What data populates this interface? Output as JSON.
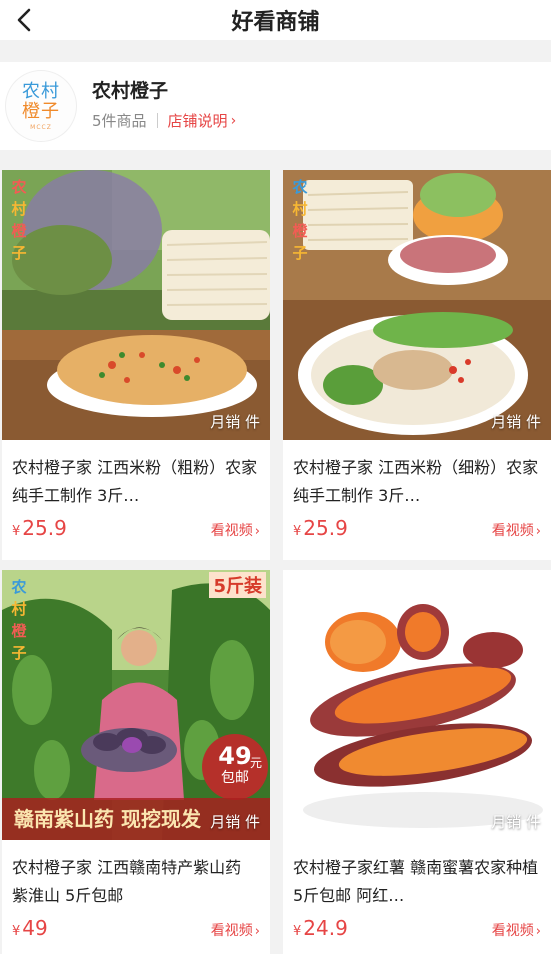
{
  "nav": {
    "title": "好看商铺"
  },
  "shop": {
    "name": "农村橙子",
    "logo": {
      "line1": "农村",
      "line2": "橙子",
      "small": "MCCZ"
    },
    "count_text": "5件商品",
    "desc_label": "店铺说明"
  },
  "products": [
    {
      "title": "农村橙子家 江西米粉（粗粉）农家纯手工制作 3斤…",
      "price": "25.9",
      "currency": "¥",
      "sales": "月销 件",
      "video_label": "看视频",
      "watermark": [
        "农",
        "村",
        "橙",
        "子"
      ]
    },
    {
      "title": "农村橙子家 江西米粉（细粉）农家纯手工制作 3斤…",
      "price": "25.9",
      "currency": "¥",
      "sales": "月销 件",
      "video_label": "看视频",
      "watermark": [
        "农",
        "村",
        "橙",
        "子"
      ]
    },
    {
      "title": "农村橙子家 江西赣南特产紫山药 紫淮山 5斤包邮",
      "price": "49",
      "currency": "¥",
      "sales": "月销 件",
      "video_label": "看视频",
      "watermark": [
        "农",
        "村",
        "橙",
        "子"
      ],
      "tag": "5斤装",
      "badge": {
        "price": "49",
        "unit": "元",
        "text": "包邮"
      },
      "banner": "赣南紫山药 现挖现发"
    },
    {
      "title": "农村橙子家红薯 赣南蜜薯农家种植 5斤包邮 阿红…",
      "price": "24.9",
      "currency": "¥",
      "sales": "月销 件",
      "video_label": "看视频"
    }
  ],
  "colors": {
    "accent": "#e64545",
    "background": "#f2f2f2",
    "card": "#ffffff"
  }
}
